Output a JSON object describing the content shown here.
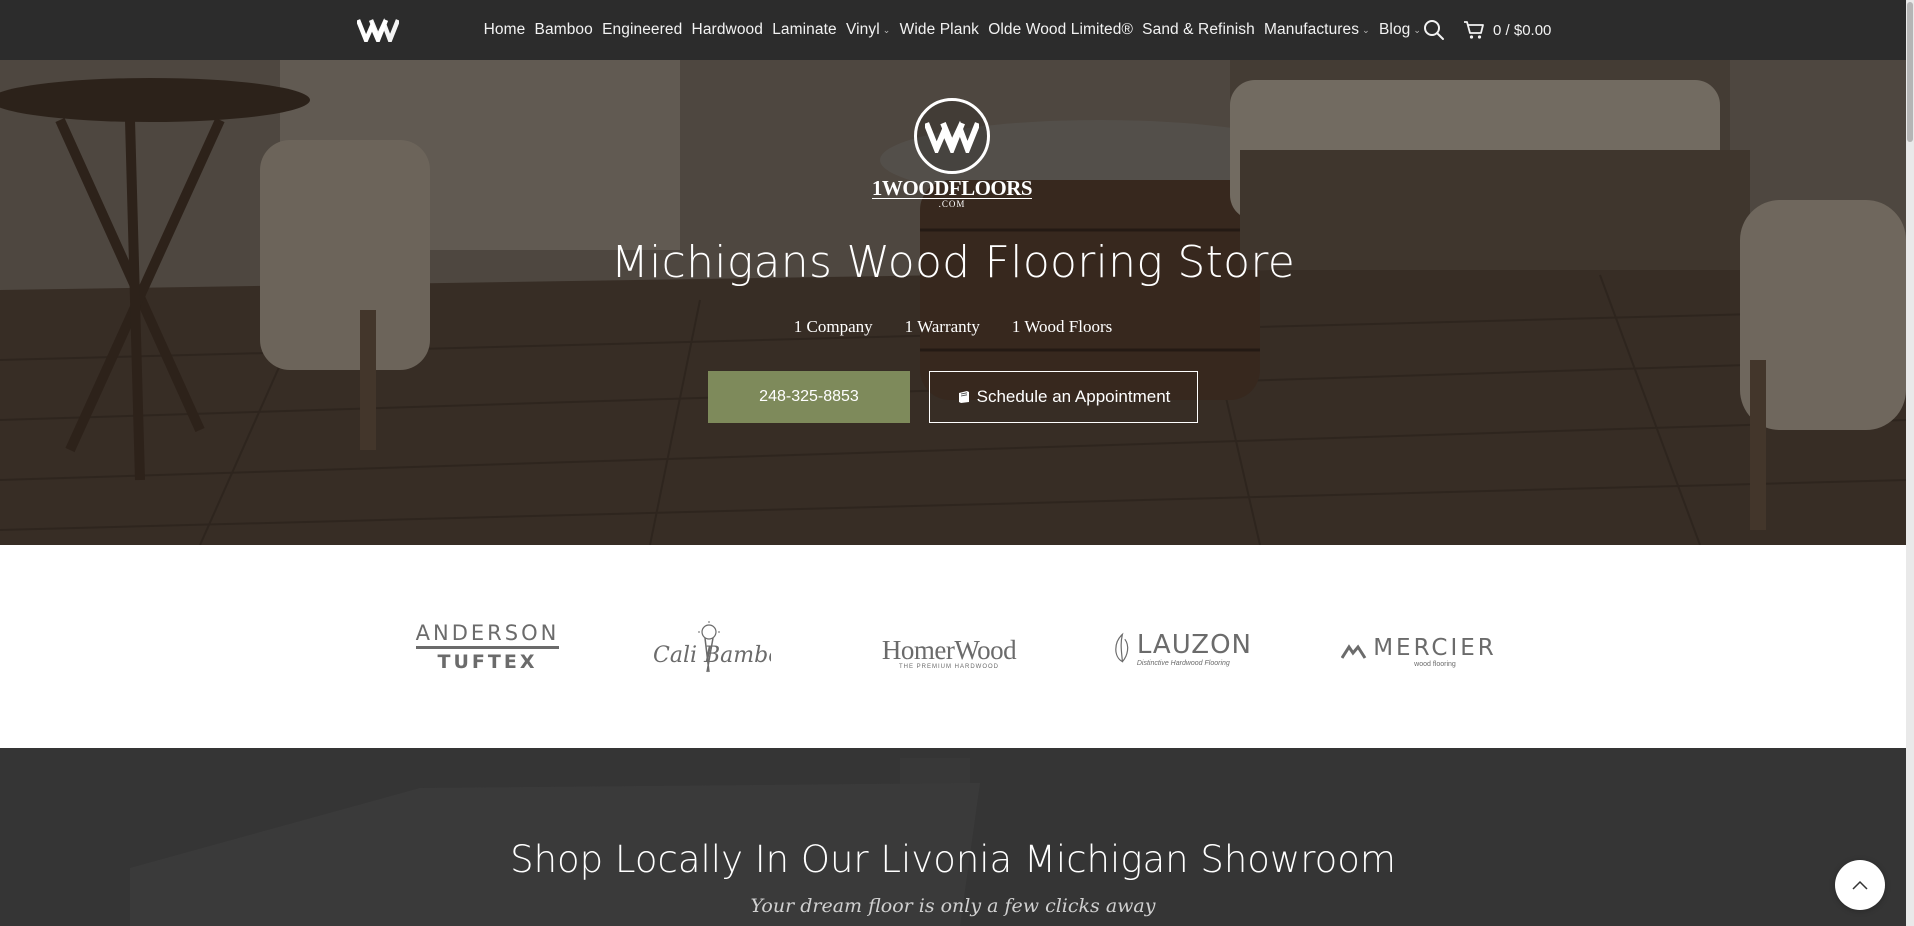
{
  "header": {
    "logo_alt": "1WoodFloors logo",
    "nav": [
      {
        "label": "Home",
        "has_dropdown": false
      },
      {
        "label": "Bamboo",
        "has_dropdown": false
      },
      {
        "label": "Engineered",
        "has_dropdown": false
      },
      {
        "label": "Hardwood",
        "has_dropdown": false
      },
      {
        "label": "Laminate",
        "has_dropdown": false
      },
      {
        "label": "Vinyl",
        "has_dropdown": true
      },
      {
        "label": "Wide Plank",
        "has_dropdown": false
      },
      {
        "label": "Olde Wood Limited®",
        "has_dropdown": false
      },
      {
        "label": "Sand & Refinish",
        "has_dropdown": false
      },
      {
        "label": "Manufactures",
        "has_dropdown": true
      },
      {
        "label": "Blog",
        "has_dropdown": true
      }
    ],
    "cart": {
      "count": "0",
      "separator": "/",
      "total": "$0.00"
    },
    "icons": {
      "search": "search-icon",
      "cart": "cart-icon",
      "dropdown": "chevron-down-icon"
    }
  },
  "hero": {
    "logo_wordmark": "1WOODFLOORS",
    "logo_dotcom": ".COM",
    "title": "Michigans Wood Flooring Store",
    "tagline": [
      "1 Company",
      "1 Warranty",
      "1 Wood Floors"
    ],
    "phone_button": "248-325-8853",
    "appointment_button": "Schedule an Appointment",
    "appointment_icon": "book-icon",
    "colors": {
      "phone_button_bg": "#7e8a5b"
    }
  },
  "brands": {
    "anderson": {
      "line1": "ANDERSON",
      "line2": "TUFTEX"
    },
    "cali": {
      "name": "Cali Bamboo"
    },
    "homerwood": {
      "name": "HomerWood",
      "tagline": "THE PREMIUM HARDWOOD"
    },
    "lauzon": {
      "name": "LAUZON",
      "tagline": "Distinctive Hardwood Flooring"
    },
    "mercier": {
      "name": "MERCIER",
      "tagline": "wood flooring"
    }
  },
  "showroom": {
    "title": "Shop Locally In Our Livonia Michigan Showroom",
    "subtitle": "Your dream floor is only a few clicks away"
  },
  "scroll_top_icon": "chevron-up-icon"
}
